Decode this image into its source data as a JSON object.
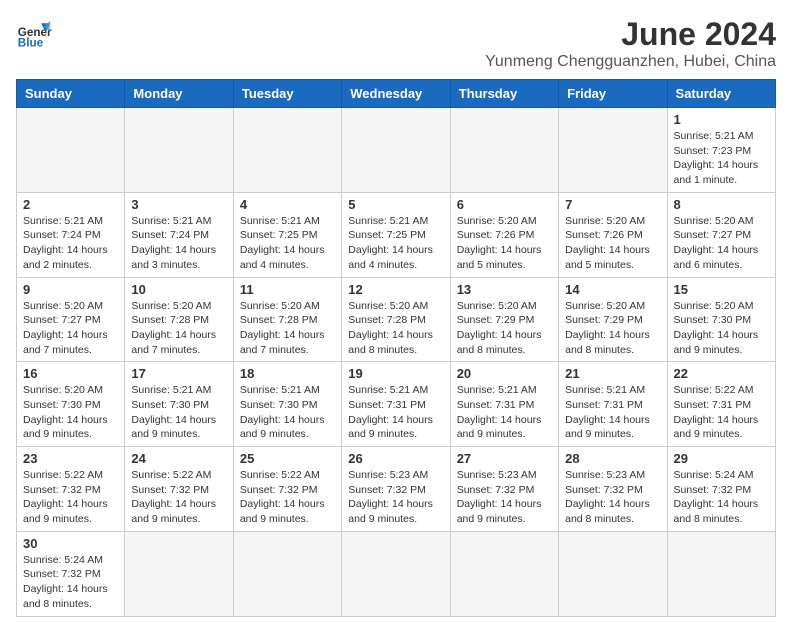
{
  "header": {
    "logo_line1": "General",
    "logo_line2": "Blue",
    "month_title": "June 2024",
    "subtitle": "Yunmeng Chengguanzhen, Hubei, China"
  },
  "weekdays": [
    "Sunday",
    "Monday",
    "Tuesday",
    "Wednesday",
    "Thursday",
    "Friday",
    "Saturday"
  ],
  "weeks": [
    [
      {
        "day": "",
        "info": ""
      },
      {
        "day": "",
        "info": ""
      },
      {
        "day": "",
        "info": ""
      },
      {
        "day": "",
        "info": ""
      },
      {
        "day": "",
        "info": ""
      },
      {
        "day": "",
        "info": ""
      },
      {
        "day": "1",
        "info": "Sunrise: 5:21 AM\nSunset: 7:23 PM\nDaylight: 14 hours\nand 1 minute."
      }
    ],
    [
      {
        "day": "2",
        "info": "Sunrise: 5:21 AM\nSunset: 7:24 PM\nDaylight: 14 hours\nand 2 minutes."
      },
      {
        "day": "3",
        "info": "Sunrise: 5:21 AM\nSunset: 7:24 PM\nDaylight: 14 hours\nand 3 minutes."
      },
      {
        "day": "4",
        "info": "Sunrise: 5:21 AM\nSunset: 7:25 PM\nDaylight: 14 hours\nand 4 minutes."
      },
      {
        "day": "5",
        "info": "Sunrise: 5:21 AM\nSunset: 7:25 PM\nDaylight: 14 hours\nand 4 minutes."
      },
      {
        "day": "6",
        "info": "Sunrise: 5:20 AM\nSunset: 7:26 PM\nDaylight: 14 hours\nand 5 minutes."
      },
      {
        "day": "7",
        "info": "Sunrise: 5:20 AM\nSunset: 7:26 PM\nDaylight: 14 hours\nand 5 minutes."
      },
      {
        "day": "8",
        "info": "Sunrise: 5:20 AM\nSunset: 7:27 PM\nDaylight: 14 hours\nand 6 minutes."
      }
    ],
    [
      {
        "day": "9",
        "info": "Sunrise: 5:20 AM\nSunset: 7:27 PM\nDaylight: 14 hours\nand 7 minutes."
      },
      {
        "day": "10",
        "info": "Sunrise: 5:20 AM\nSunset: 7:28 PM\nDaylight: 14 hours\nand 7 minutes."
      },
      {
        "day": "11",
        "info": "Sunrise: 5:20 AM\nSunset: 7:28 PM\nDaylight: 14 hours\nand 7 minutes."
      },
      {
        "day": "12",
        "info": "Sunrise: 5:20 AM\nSunset: 7:28 PM\nDaylight: 14 hours\nand 8 minutes."
      },
      {
        "day": "13",
        "info": "Sunrise: 5:20 AM\nSunset: 7:29 PM\nDaylight: 14 hours\nand 8 minutes."
      },
      {
        "day": "14",
        "info": "Sunrise: 5:20 AM\nSunset: 7:29 PM\nDaylight: 14 hours\nand 8 minutes."
      },
      {
        "day": "15",
        "info": "Sunrise: 5:20 AM\nSunset: 7:30 PM\nDaylight: 14 hours\nand 9 minutes."
      }
    ],
    [
      {
        "day": "16",
        "info": "Sunrise: 5:20 AM\nSunset: 7:30 PM\nDaylight: 14 hours\nand 9 minutes."
      },
      {
        "day": "17",
        "info": "Sunrise: 5:21 AM\nSunset: 7:30 PM\nDaylight: 14 hours\nand 9 minutes."
      },
      {
        "day": "18",
        "info": "Sunrise: 5:21 AM\nSunset: 7:30 PM\nDaylight: 14 hours\nand 9 minutes."
      },
      {
        "day": "19",
        "info": "Sunrise: 5:21 AM\nSunset: 7:31 PM\nDaylight: 14 hours\nand 9 minutes."
      },
      {
        "day": "20",
        "info": "Sunrise: 5:21 AM\nSunset: 7:31 PM\nDaylight: 14 hours\nand 9 minutes."
      },
      {
        "day": "21",
        "info": "Sunrise: 5:21 AM\nSunset: 7:31 PM\nDaylight: 14 hours\nand 9 minutes."
      },
      {
        "day": "22",
        "info": "Sunrise: 5:22 AM\nSunset: 7:31 PM\nDaylight: 14 hours\nand 9 minutes."
      }
    ],
    [
      {
        "day": "23",
        "info": "Sunrise: 5:22 AM\nSunset: 7:32 PM\nDaylight: 14 hours\nand 9 minutes."
      },
      {
        "day": "24",
        "info": "Sunrise: 5:22 AM\nSunset: 7:32 PM\nDaylight: 14 hours\nand 9 minutes."
      },
      {
        "day": "25",
        "info": "Sunrise: 5:22 AM\nSunset: 7:32 PM\nDaylight: 14 hours\nand 9 minutes."
      },
      {
        "day": "26",
        "info": "Sunrise: 5:23 AM\nSunset: 7:32 PM\nDaylight: 14 hours\nand 9 minutes."
      },
      {
        "day": "27",
        "info": "Sunrise: 5:23 AM\nSunset: 7:32 PM\nDaylight: 14 hours\nand 9 minutes."
      },
      {
        "day": "28",
        "info": "Sunrise: 5:23 AM\nSunset: 7:32 PM\nDaylight: 14 hours\nand 8 minutes."
      },
      {
        "day": "29",
        "info": "Sunrise: 5:24 AM\nSunset: 7:32 PM\nDaylight: 14 hours\nand 8 minutes."
      }
    ],
    [
      {
        "day": "30",
        "info": "Sunrise: 5:24 AM\nSunset: 7:32 PM\nDaylight: 14 hours\nand 8 minutes."
      },
      {
        "day": "",
        "info": ""
      },
      {
        "day": "",
        "info": ""
      },
      {
        "day": "",
        "info": ""
      },
      {
        "day": "",
        "info": ""
      },
      {
        "day": "",
        "info": ""
      },
      {
        "day": "",
        "info": ""
      }
    ]
  ]
}
